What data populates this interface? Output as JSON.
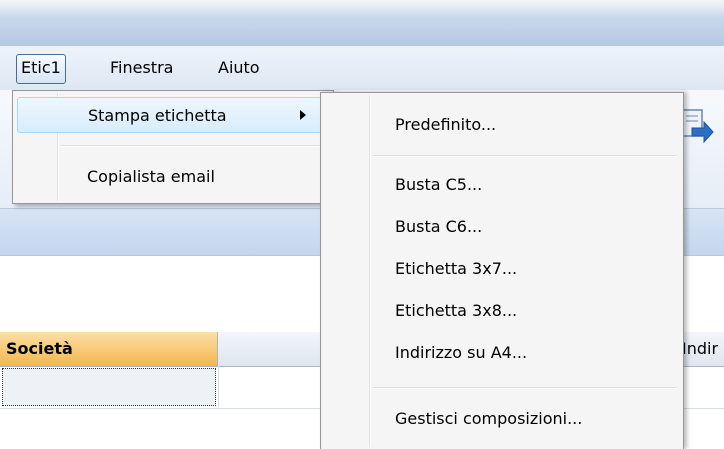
{
  "menubar": {
    "items": [
      {
        "label": "Etic1"
      },
      {
        "label": "Finestra"
      },
      {
        "label": "Aiuto"
      }
    ]
  },
  "menu": {
    "items": [
      {
        "label": "Stampa etichetta",
        "has_submenu": true
      },
      {
        "label": "Copialista email"
      }
    ]
  },
  "submenu": {
    "items": [
      {
        "label": "Predefinito..."
      },
      {
        "label": "Busta C5..."
      },
      {
        "label": "Busta C6..."
      },
      {
        "label": "Etichetta 3x7..."
      },
      {
        "label": "Etichetta 3x8..."
      },
      {
        "label": "Indirizzo su A4..."
      },
      {
        "label": "Gestisci composizioni..."
      }
    ]
  },
  "grid": {
    "columns": [
      "Società",
      "Indir"
    ]
  },
  "colors": {
    "accent": "#f3b64d",
    "highlight_border": "#a8d8f7",
    "band": "#c4d6ee"
  }
}
